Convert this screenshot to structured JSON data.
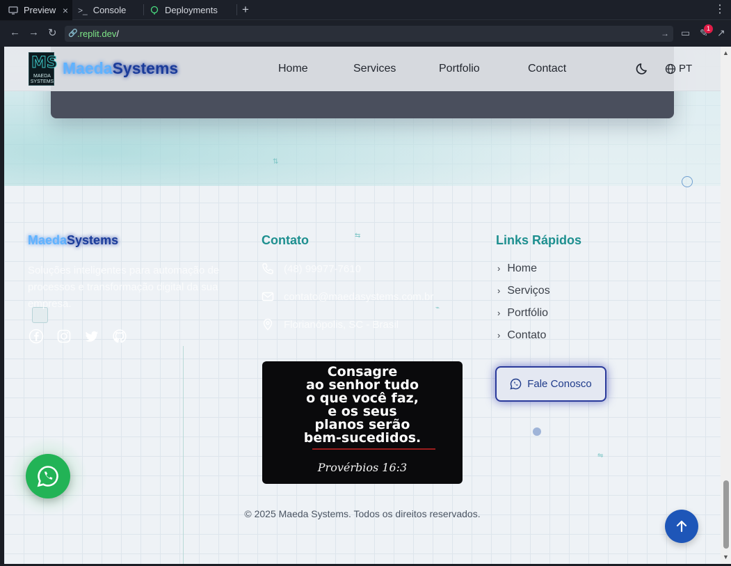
{
  "browser": {
    "tabs": [
      {
        "label": "Preview",
        "icon": "monitor-icon"
      },
      {
        "label": "Console",
        "icon": "terminal-icon"
      },
      {
        "label": "Deployments",
        "icon": "deployments-icon"
      }
    ],
    "url_host": ".replit.dev",
    "url_path": "/",
    "notification_count": "1"
  },
  "navbar": {
    "logo_letters": "MS",
    "logo_sub1": "MAEDA",
    "logo_sub2": "SYSTEMS",
    "brand_a": "Maeda",
    "brand_b": "Systems",
    "links": [
      "Home",
      "Services",
      "Portfolio",
      "Contact"
    ],
    "lang": "PT"
  },
  "footer": {
    "brand_a": "Maeda",
    "brand_b": "Systems",
    "description": "Soluções inteligentes para automação de processos e transformação digital da sua empresa.",
    "contact_title": "Contato",
    "phone": "(48) 99977-7610",
    "email": "contato@maedasystems.com.br",
    "location": "Florianópolis, SC - Brasil",
    "links_title": "Links Rápidos",
    "quick_links": [
      "Home",
      "Serviços",
      "Portfólio",
      "Contato"
    ],
    "cta": "Fale Conosco",
    "verse_lines": [
      "Consagre",
      "ao senhor tudo",
      "o que você faz,",
      "e os seus",
      "planos serão",
      "bem-sucedidos."
    ],
    "verse_ref": "Provérbios 16:3",
    "copyright": "© 2025 Maeda Systems. Todos os direitos reservados."
  },
  "colors": {
    "accent_teal": "#1d8f8f",
    "brand_blue": "#1b3c9a",
    "whatsapp_green": "#22b356",
    "scroll_top_blue": "#1e56b8"
  }
}
